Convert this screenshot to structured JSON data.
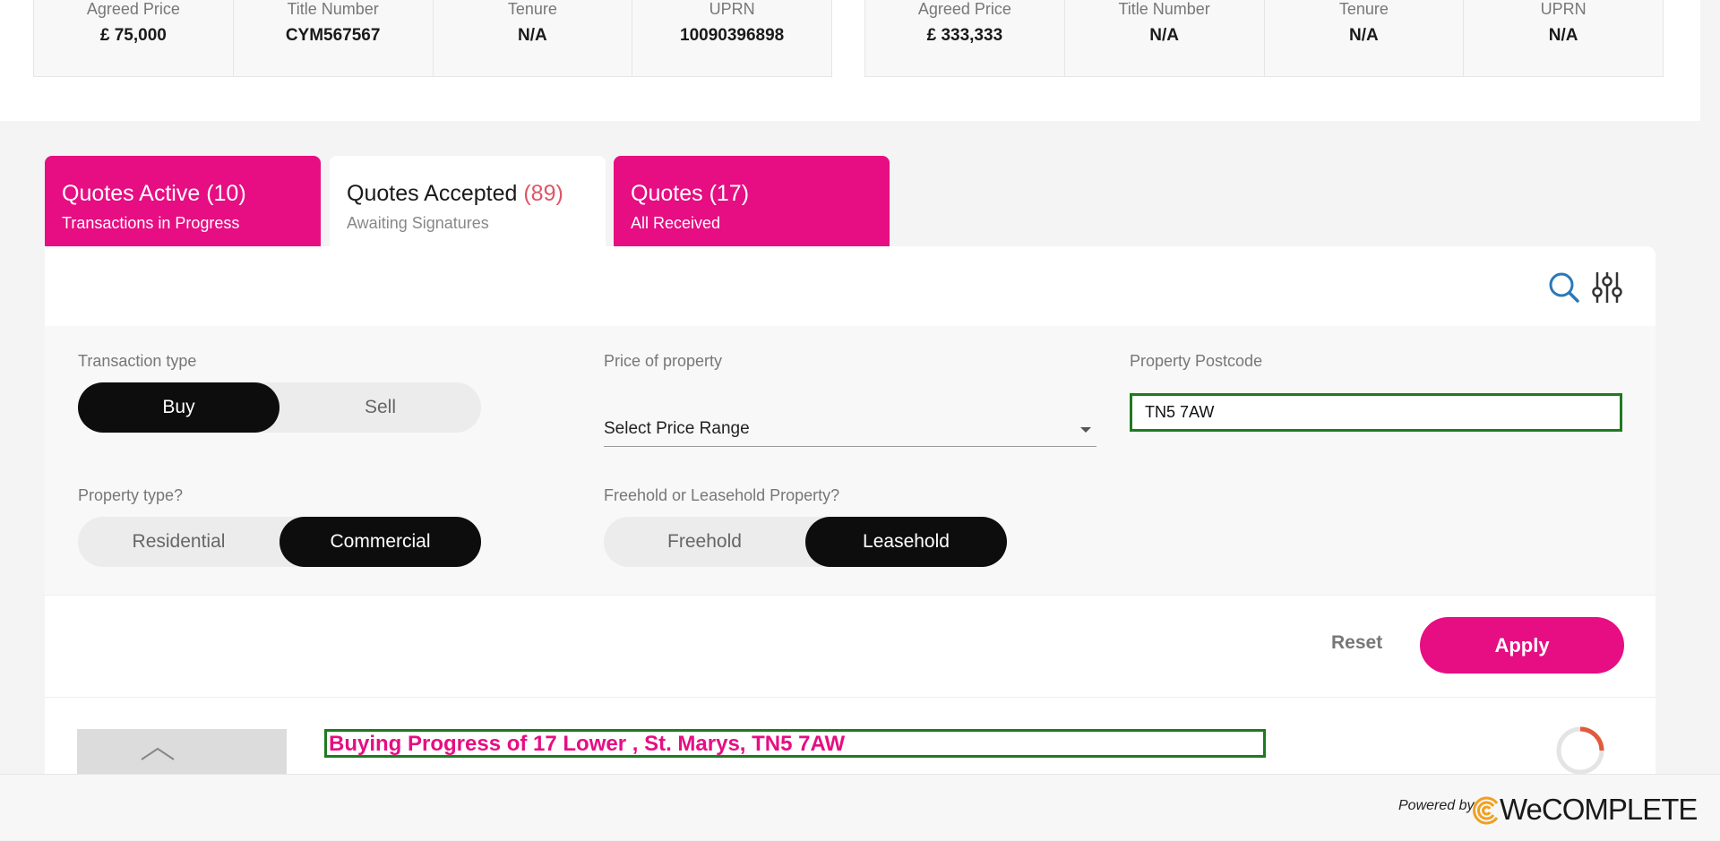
{
  "property_cards": [
    {
      "fields": [
        {
          "label": "Agreed Price",
          "value": "£ 75,000"
        },
        {
          "label": "Title Number",
          "value": "CYM567567"
        },
        {
          "label": "Tenure",
          "value": "N/A"
        },
        {
          "label": "UPRN",
          "value": "10090396898"
        }
      ]
    },
    {
      "fields": [
        {
          "label": "Agreed Price",
          "value": "£ 333,333"
        },
        {
          "label": "Title Number",
          "value": "N/A"
        },
        {
          "label": "Tenure",
          "value": "N/A"
        },
        {
          "label": "UPRN",
          "value": "N/A"
        }
      ]
    }
  ],
  "tabs": [
    {
      "title": "Quotes Active",
      "count": "(10)",
      "subtitle": "Transactions in Progress",
      "active": false
    },
    {
      "title": "Quotes Accepted",
      "count": "(89)",
      "subtitle": "Awaiting Signatures",
      "active": true
    },
    {
      "title": "Quotes",
      "count": "(17)",
      "subtitle": "All Received",
      "active": false
    }
  ],
  "toolbar": {
    "search_icon": "search-icon",
    "filter_icon": "sliders-icon"
  },
  "filters": {
    "transaction_type": {
      "label": "Transaction type",
      "options": [
        "Buy",
        "Sell"
      ],
      "selected": "Buy"
    },
    "price": {
      "label": "Price of property",
      "value": "Select Price Range"
    },
    "postcode": {
      "label": "Property Postcode",
      "value": "TN5 7AW"
    },
    "property_type": {
      "label": "Property type?",
      "options": [
        "Residential",
        "Commercial"
      ],
      "selected": "Commercial"
    },
    "tenure": {
      "label": "Freehold or Leasehold Property?",
      "options": [
        "Freehold",
        "Leasehold"
      ],
      "selected": "Leasehold"
    }
  },
  "actions": {
    "reset_label": "Reset",
    "apply_label": "Apply"
  },
  "result": {
    "title": "Buying Progress of 17 Lower , St. Marys, TN5 7AW"
  },
  "footer": {
    "powered_by": "Powered by",
    "brand": "WeCOMPLETE"
  },
  "colors": {
    "accent": "#e60e82",
    "highlight_border": "#1f7a1f",
    "count_red": "#e05564"
  }
}
